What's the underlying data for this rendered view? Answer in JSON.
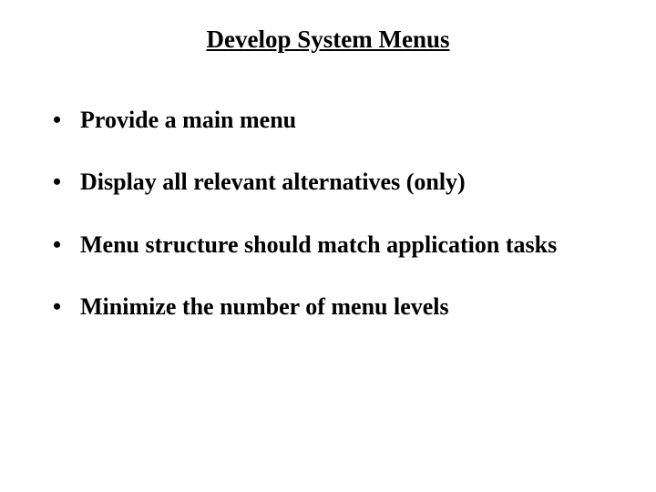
{
  "slide": {
    "title": "Develop System Menus",
    "bullets": [
      "Provide a main menu",
      "Display all relevant alternatives (only)",
      "Menu structure should match application tasks",
      "Minimize the number of menu levels"
    ]
  }
}
